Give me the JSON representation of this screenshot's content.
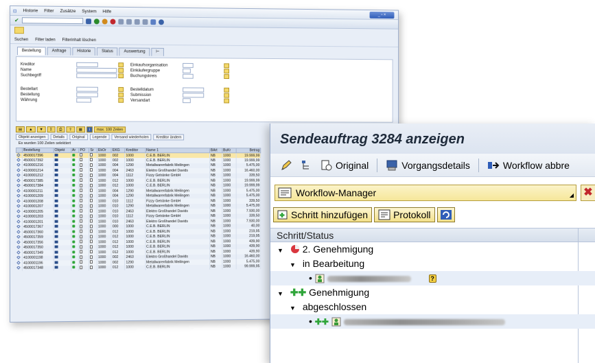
{
  "back_window": {
    "menu": [
      "Historie",
      "Filter",
      "Zusätze",
      "System",
      "Hilfe"
    ],
    "app_toolbar": [
      "Suchen",
      "Filter laden",
      "Filterinhalt löschen"
    ],
    "tabs": [
      "Bestellung",
      "Anfrage",
      "Historie",
      "Status",
      "Auswertung"
    ],
    "form_labels_left": [
      "Kreditor",
      "Name",
      "Suchbegriff",
      "Bestellart",
      "Bestellung",
      "Währung"
    ],
    "form_labels_right": [
      "Einkaufsorganisation",
      "Einkäufergruppe",
      "Buchungskreis",
      "Bestelldatum",
      "Submission",
      "Versandart"
    ],
    "max_rows": "max. 100 Zeilen",
    "grid_buttons": [
      "Objekt anzeigen",
      "Details",
      "Original",
      "Legende",
      "Versand wiederholen",
      "Kreditor ändern"
    ],
    "selection_info": "Es wurden 100 Zeilen selektiert",
    "columns": [
      "Bestellung",
      "Objekt",
      "Ar",
      "PO",
      "Sr",
      "EkOr",
      "EKG",
      "Kreditor",
      "Name 1",
      "BArt",
      "BuKr",
      "Betrag"
    ],
    "rows": [
      [
        "4500017396",
        "1000",
        "002",
        "1000",
        "C.E.B. BERLIN",
        "NB",
        "1000",
        "19.999,99"
      ],
      [
        "4500017392",
        "1000",
        "002",
        "1000",
        "C.E.B. BERLIN",
        "NB",
        "1000",
        "19.999,99"
      ],
      [
        "4100001216",
        "1000",
        "004",
        "1290",
        "Metallwarenfabrik Meilingen",
        "NB",
        "1000",
        "5.475,00"
      ],
      [
        "4100001214",
        "1000",
        "004",
        "2463",
        "Elektro Großhandel Davids",
        "NB",
        "1000",
        "16.460,00"
      ],
      [
        "4100001212",
        "1000",
        "004",
        "1112",
        "Fizzy Getränke GmbH",
        "NB",
        "1000",
        "339,50"
      ],
      [
        "4500017385",
        "1000",
        "012",
        "1000",
        "C.E.B. BERLIN",
        "NB",
        "1000",
        "19.999,99"
      ],
      [
        "4500017384",
        "1000",
        "012",
        "1000",
        "C.E.B. BERLIN",
        "NB",
        "1000",
        "19.999,99"
      ],
      [
        "4100001211",
        "1000",
        "004",
        "1290",
        "Metallwarenfabrik Meilingen",
        "NB",
        "1000",
        "5.475,00"
      ],
      [
        "4100001209",
        "1000",
        "004",
        "1290",
        "Metallwarenfabrik Meilingen",
        "NB",
        "1000",
        "5.475,00"
      ],
      [
        "4100001208",
        "1000",
        "010",
        "1112",
        "Fizzy Getränke GmbH",
        "NB",
        "1000",
        "339,50"
      ],
      [
        "4100001207",
        "1000",
        "010",
        "1290",
        "Metallwarenfabrik Meilingen",
        "NB",
        "1000",
        "5.475,00"
      ],
      [
        "4100001205",
        "1000",
        "010",
        "2463",
        "Elektro Großhandel Davids",
        "NB",
        "1000",
        "7.930,00"
      ],
      [
        "4100001203",
        "1000",
        "010",
        "1112",
        "Fizzy Getränke GmbH",
        "NB",
        "1000",
        "339,50"
      ],
      [
        "4100001201",
        "1000",
        "010",
        "2463",
        "Elektro Großhandel Davids",
        "NB",
        "1000",
        "7.930,00"
      ],
      [
        "4500017367",
        "1000",
        "000",
        "1000",
        "C.E.B. BERLIN",
        "NB",
        "1000",
        "40,00"
      ],
      [
        "4500017360",
        "1000",
        "012",
        "1000",
        "C.E.B. BERLIN",
        "NB",
        "1000",
        "219,95"
      ],
      [
        "4500017359",
        "1000",
        "012",
        "1000",
        "C.E.B. BERLIN",
        "NB",
        "1000",
        "219,95"
      ],
      [
        "4500017356",
        "1000",
        "012",
        "1000",
        "C.E.B. BERLIN",
        "NB",
        "1000",
        "439,90"
      ],
      [
        "4500017350",
        "1000",
        "012",
        "1000",
        "C.E.B. BERLIN",
        "NB",
        "1000",
        "439,90"
      ],
      [
        "4500017349",
        "1000",
        "012",
        "1000",
        "C.E.B. BERLIN",
        "NB",
        "1000",
        "439,90"
      ],
      [
        "4100001198",
        "1000",
        "002",
        "2463",
        "Elektro Großhandel Davids",
        "NB",
        "1000",
        "16.460,00"
      ],
      [
        "4100001196",
        "1000",
        "002",
        "1290",
        "Metallwarenfabrik Meilingen",
        "NB",
        "1000",
        "5.475,00"
      ],
      [
        "4500017348",
        "1000",
        "012",
        "1000",
        "C.E.B. BERLIN",
        "NB",
        "1000",
        "99.999,95"
      ]
    ]
  },
  "popup": {
    "title": "Sendeauftrag 3284 anzeigen",
    "toolbar": {
      "original": "Original",
      "vorgangsdetails": "Vorgangsdetails",
      "workflow": "Workflow abbre"
    },
    "workflow_manager": "Workflow-Manager",
    "add_step": "Schritt hinzufügen",
    "protokoll": "Protokoll",
    "tree_header": "Schritt/Status",
    "tree": {
      "step1": "2. Genehmigung",
      "step1_status": "in Bearbeitung",
      "step2": "Genehmigung",
      "step2_status": "abgeschlossen"
    }
  },
  "colors": {
    "sap_yellow": "#f4d96b",
    "header_blue": "#d6dfeb",
    "green_status": "#2fa53a",
    "red_error": "#c1272d"
  }
}
